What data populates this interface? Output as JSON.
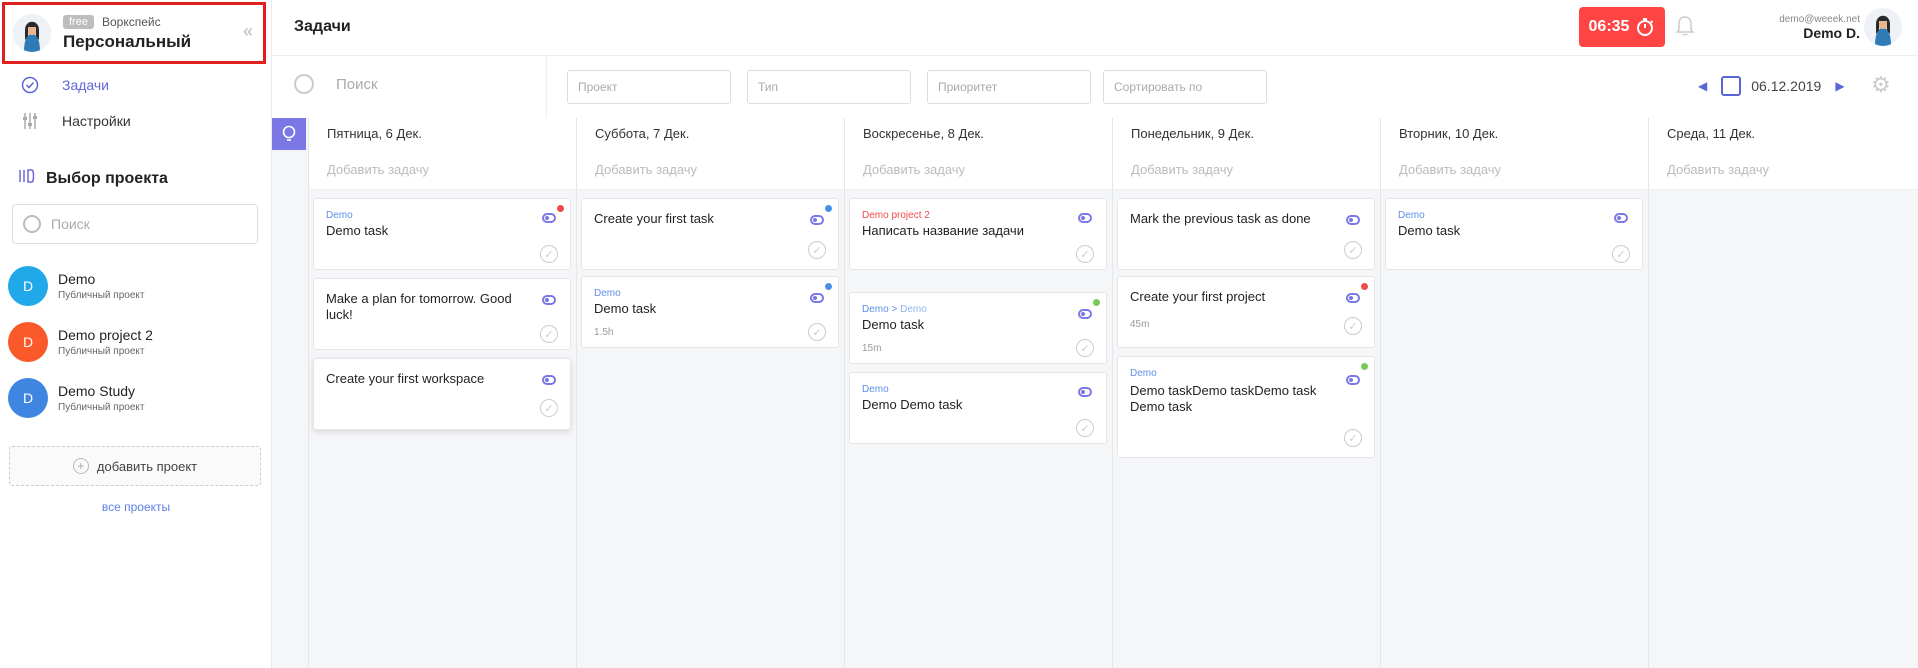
{
  "sidebar": {
    "workspace": {
      "badge": "free",
      "label": "Воркспейс",
      "name": "Персональный"
    },
    "nav": [
      {
        "label": "Задачи",
        "icon": "check-circle-icon"
      },
      {
        "label": "Настройки",
        "icon": "sliders-icon"
      }
    ],
    "projects_title": "Выбор проекта",
    "search_placeholder": "Поиск",
    "projects": [
      {
        "initial": "D",
        "name": "Demo",
        "sub": "Публичный проект",
        "color": "#21a8e8"
      },
      {
        "initial": "D",
        "name": "Demo project 2",
        "sub": "Публичный проект",
        "color": "#fa5a2a"
      },
      {
        "initial": "D",
        "name": "Demo Study",
        "sub": "Публичный проект",
        "color": "#3e86e0"
      }
    ],
    "add_project": "добавить проект",
    "all_projects": "все проекты"
  },
  "header": {
    "title": "Задачи",
    "timer": "06:35",
    "user_email": "demo@weeek.net",
    "user_name": "Demo D."
  },
  "toolbar": {
    "search_placeholder": "Поиск",
    "filters": [
      "Проект",
      "Тип",
      "Приоритет",
      "Сортировать по"
    ],
    "date": "06.12.2019"
  },
  "columns": [
    {
      "date": "Пятница, 6 Дек.",
      "add": "Добавить задачу"
    },
    {
      "date": "Суббота, 7 Дек.",
      "add": "Добавить задачу"
    },
    {
      "date": "Воскресенье, 8 Дек.",
      "add": "Добавить задачу"
    },
    {
      "date": "Понедельник, 9 Дек.",
      "add": "Добавить задачу"
    },
    {
      "date": "Вторник, 10 Дек.",
      "add": "Добавить задачу"
    },
    {
      "date": "Среда, 11 Дек.",
      "add": "Добавить задачу"
    }
  ],
  "cards": [
    {
      "tag": "Demo",
      "title": "Demo task"
    },
    {
      "title": "Make a plan for tomorrow. Good luck!"
    },
    {
      "title": "Create your first workspace"
    },
    {
      "title": "Create your first task"
    },
    {
      "tag": "Demo",
      "title": "Demo task",
      "duration": "1.5h"
    },
    {
      "tag": "Demo project 2",
      "title": "Написать название задачи"
    },
    {
      "tag": "Demo",
      "tag_sep": " > ",
      "tag_sub": "Demo",
      "title": "Demo task",
      "duration": "15m"
    },
    {
      "tag": "Demo",
      "title": "Demo Demo task"
    },
    {
      "title": "Mark the previous task as done"
    },
    {
      "title": "Create your first project",
      "duration": "45m"
    },
    {
      "tag": "Demo",
      "title": "Demo taskDemo taskDemo task Demo task"
    },
    {
      "tag": "Demo",
      "title": "Demo task"
    }
  ],
  "colors": {
    "accent": "#6066d6",
    "timer": "#ff4444",
    "priority_red": "#f04a4a",
    "priority_blue": "#4a8fe6",
    "priority_green": "#7cc95a"
  }
}
